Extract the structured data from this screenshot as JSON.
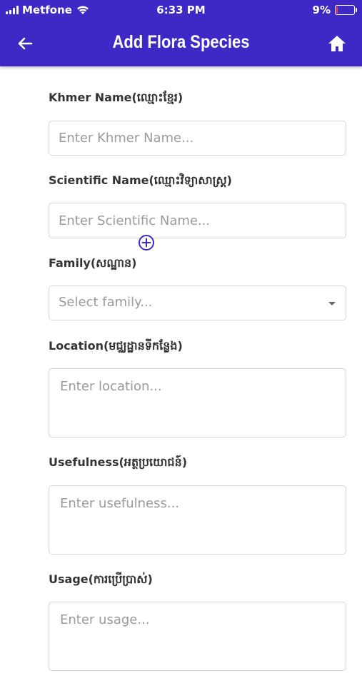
{
  "status_bar": {
    "carrier": "Metfone",
    "time": "6:33 PM",
    "battery": "9%",
    "battery_level": 0.09
  },
  "header": {
    "title": "Add Flora Species",
    "back_icon": "arrow-left-icon",
    "home_icon": "home-icon",
    "background": "#3f29c6"
  },
  "form": {
    "khmer_name": {
      "label": "Khmer Name(ឈ្មោះខ្មែរ)",
      "placeholder": "Enter Khmer Name..."
    },
    "scientific_name": {
      "label": "Scientific Name(ឈ្មោះវិទ្យាសាស្ត្រ)",
      "placeholder": "Enter Scientific Name..."
    },
    "family": {
      "label": "Family(សណ្ឋាន)",
      "placeholder": "Select family..."
    },
    "location": {
      "label": "Location(មជ្ឈដ្ឋានទីកន្លែង)",
      "placeholder": "Enter location..."
    },
    "usefulness": {
      "label": "Usefulness(អត្ថប្រយោជន៍)",
      "placeholder": "Enter usefulness..."
    },
    "usage": {
      "label": "Usage(ការប្រើប្រាស់)",
      "placeholder": "Enter usage..."
    }
  },
  "add_icon": "plus-circle-icon"
}
